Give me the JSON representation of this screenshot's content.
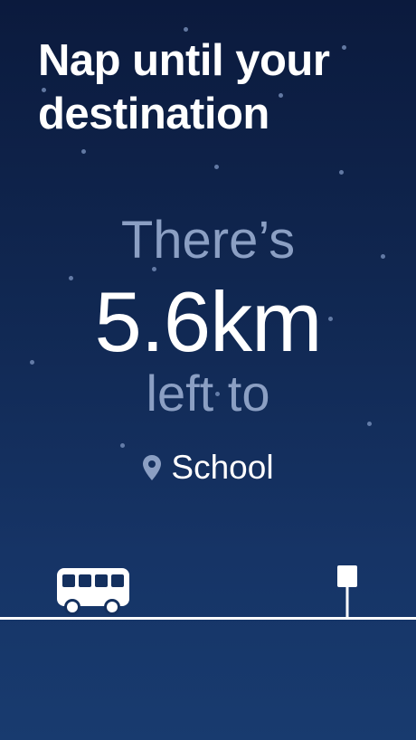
{
  "headline": "Nap until your destination",
  "status": {
    "prefix": "There’s",
    "distance": "5.6km",
    "suffix": "left to"
  },
  "destination": {
    "icon": "location-pin-icon",
    "label": "School"
  },
  "scene": {
    "vehicle_icon": "bus-icon",
    "stop_icon": "bus-stop-sign-icon"
  },
  "colors": {
    "background_top": "#0b1a3d",
    "background_bottom": "#183b6f",
    "muted_text": "#8b9fc3",
    "primary_text": "#ffffff"
  }
}
